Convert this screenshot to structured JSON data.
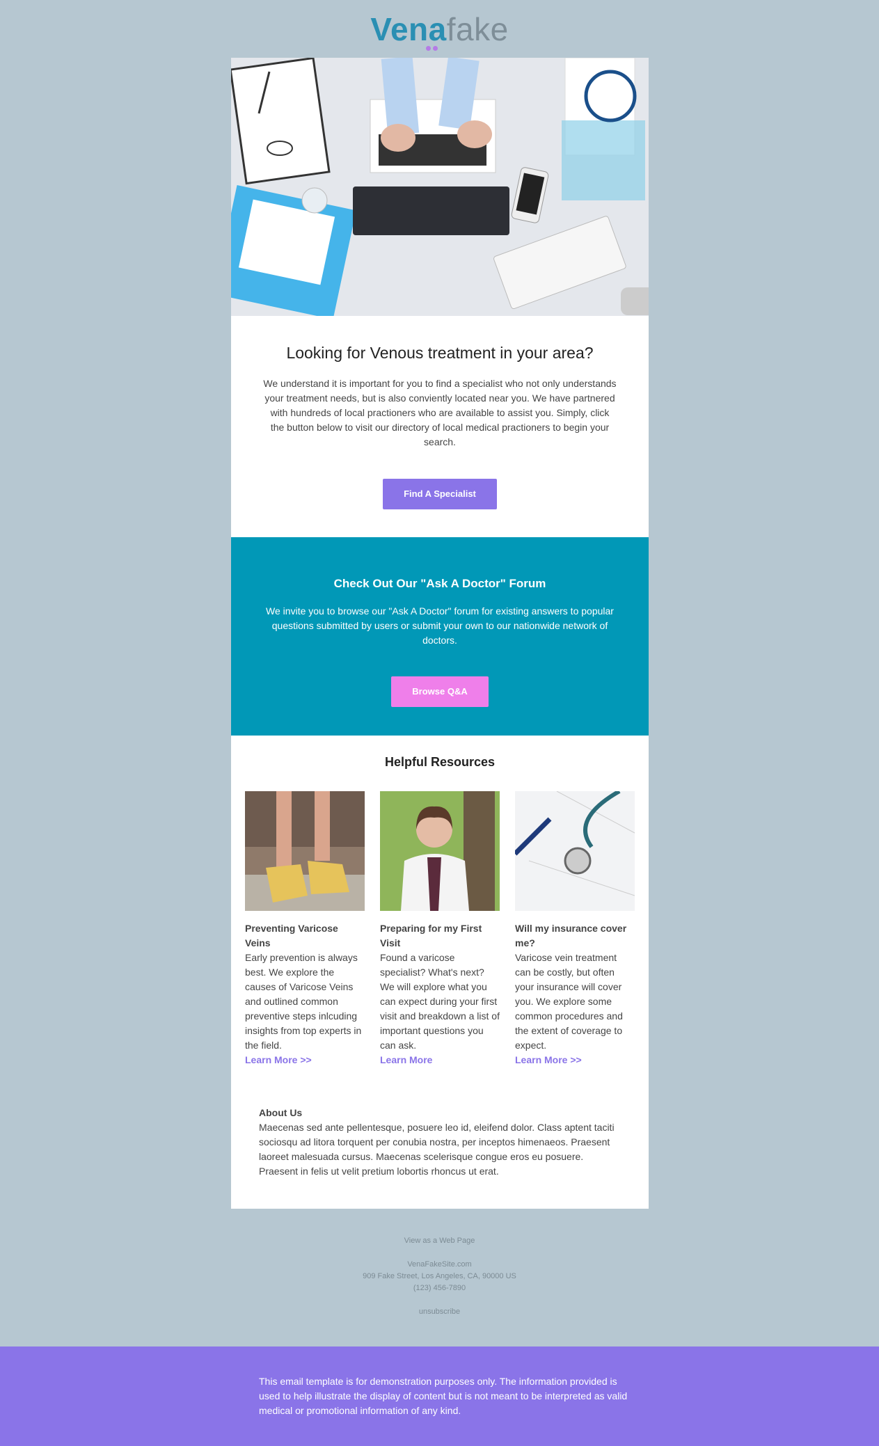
{
  "logo": {
    "part1": "Vena",
    "part2": "fake"
  },
  "colors": {
    "background": "#b6c7d1",
    "teal": "#0198b7",
    "purple": "#8a74e8",
    "pink": "#ef7fea"
  },
  "hero": {
    "image": "doctor-desk-laptop-photo"
  },
  "intro": {
    "heading": "Looking for Venous treatment in your area?",
    "body": "We understand it is important for you to find a specialist who not only understands your treatment needs, but is also conviently located near you. We have partnered with hundreds of local practioners who are available to assist you. Simply, click the button below to visit our directory of local medical practioners to begin your search.",
    "button": "Find A Specialist"
  },
  "forum": {
    "heading": "Check Out Our \"Ask A Doctor\" Forum",
    "body": "We invite you to browse our \"Ask A Doctor\" forum for existing answers to popular questions submitted by users or submit your own to our nationwide network of doctors.",
    "button": "Browse Q&A"
  },
  "resources": {
    "heading": "Helpful Resources",
    "items": [
      {
        "title": "Preventing Varicose Veins",
        "desc": "Early prevention is always best. We explore the causes of Varicose Veins and outlined common preventive steps inlcuding insights from top experts in the field.",
        "link": "Learn More >>",
        "image": "legs-sandals-photo"
      },
      {
        "title": "Preparing for my First Visit",
        "desc": "Found a varicose specialist? What's next? We will explore what you can expect during your first visit and breakdown a list of important questions you can ask.",
        "link": "Learn More",
        "image": "female-doctor-photo"
      },
      {
        "title": "Will my insurance cover me?",
        "desc": "Varicose vein treatment can be costly, but often your insurance will cover you. We explore some common procedures and the extent of coverage to expect.",
        "link": "Learn More >>",
        "image": "stethoscope-paperwork-photo"
      }
    ]
  },
  "about": {
    "title": "About Us",
    "body": "Maecenas sed ante pellentesque, posuere leo id, eleifend dolor. Class aptent taciti sociosqu ad litora torquent per conubia nostra, per inceptos himenaeos. Praesent laoreet malesuada cursus. Maecenas scelerisque congue eros eu posuere. Praesent in felis ut velit pretium lobortis rhoncus ut erat."
  },
  "footer": {
    "view_web": "View as a Web Page",
    "site": "VenaFakeSite.com",
    "address": "909 Fake Street, Los Angeles, CA, 90000 US",
    "phone": "(123) 456-7890",
    "unsubscribe": "unsubscribe"
  },
  "disclaimer": "This email template is for demonstration purposes only. The information provided is used to help illustrate the display of content but is not meant to be interpreted as valid medical or promotional information of any kind."
}
